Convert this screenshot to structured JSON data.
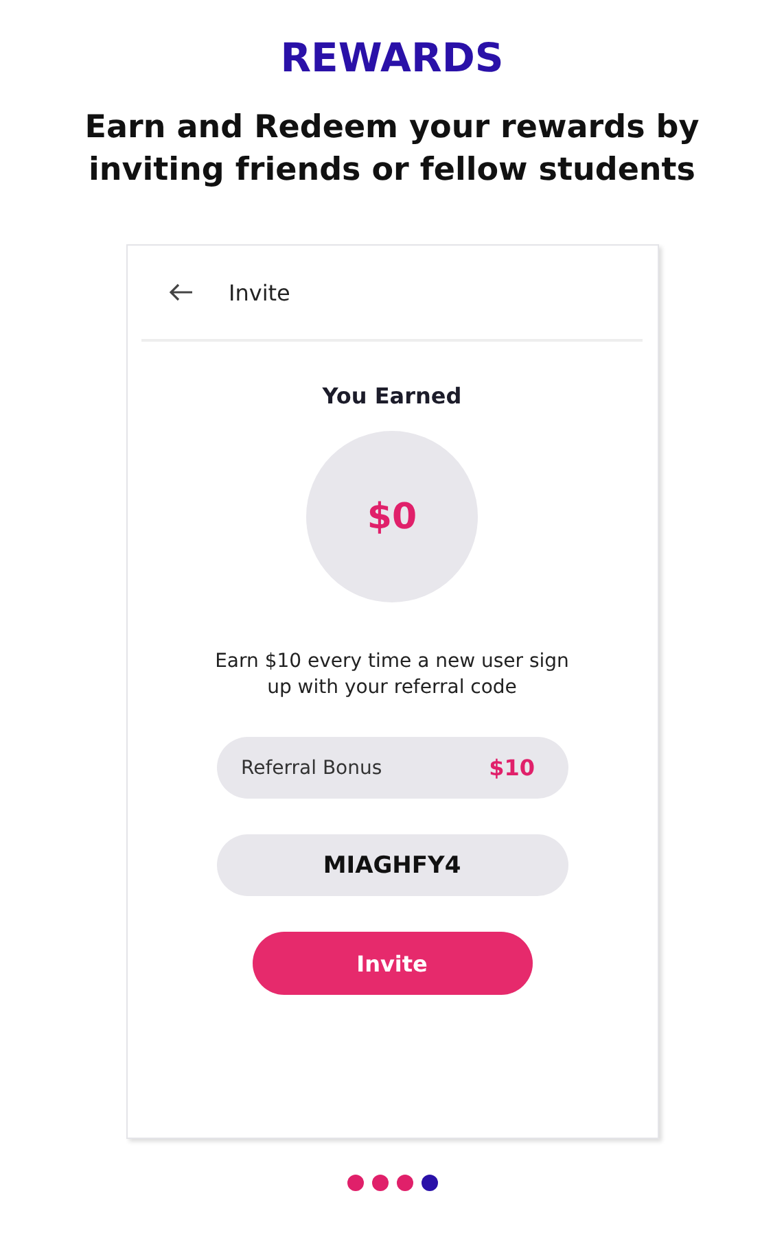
{
  "heading": "REWARDS",
  "subtitle": "Earn and Redeem your rewards by inviting friends or fellow students",
  "screen": {
    "title": "Invite",
    "earned_label": "You Earned",
    "earned_amount": "$0",
    "description": "Earn $10 every time a new user sign up with your referral code",
    "bonus": {
      "label": "Referral Bonus",
      "amount": "$10"
    },
    "referral_code": "MIAGHFY4",
    "button": "Invite"
  },
  "pager": [
    {
      "selected": false
    },
    {
      "selected": false
    },
    {
      "selected": false
    },
    {
      "selected": true
    }
  ]
}
